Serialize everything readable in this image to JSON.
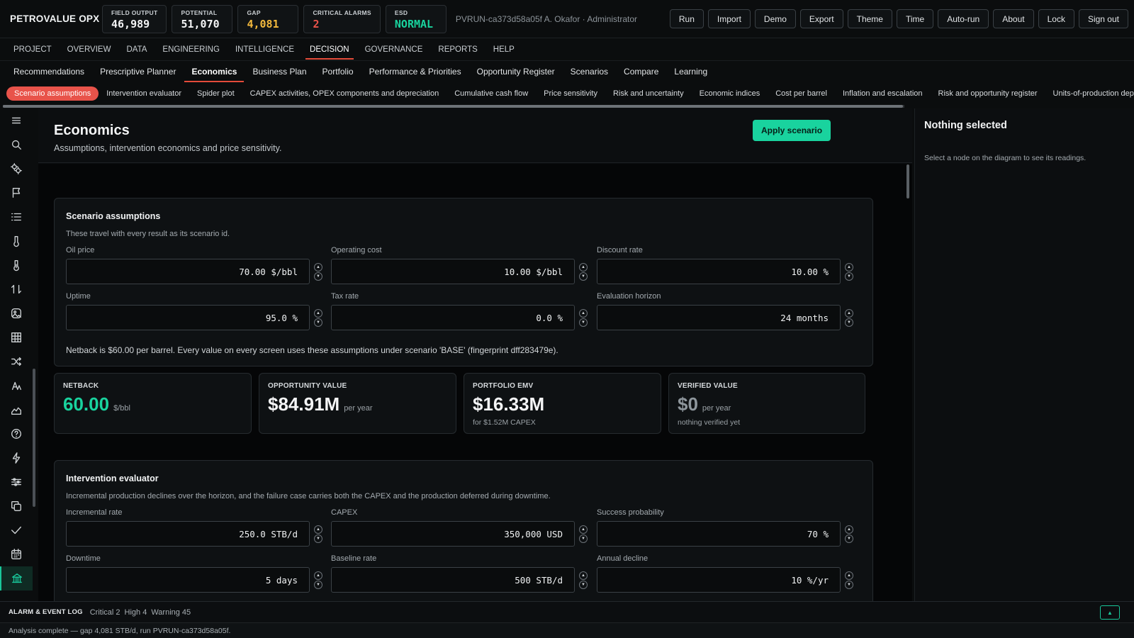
{
  "brand": "PETROVALUE OPX",
  "kpis": [
    {
      "label": "FIELD OUTPUT",
      "value": "46,989",
      "color": "#f3f4f5"
    },
    {
      "label": "POTENTIAL",
      "value": "51,070",
      "color": "#f3f4f5"
    },
    {
      "label": "GAP",
      "value": "4,081",
      "color": "#f3b93d"
    },
    {
      "label": "CRITICAL ALARMS",
      "value": "2",
      "color": "#e8534a"
    },
    {
      "label": "ESD",
      "value": "NORMAL",
      "color": "#19d39e"
    }
  ],
  "run_info": "PVRUN-ca373d58a05f   A. Okafor · Administrator",
  "top_actions": [
    "Run",
    "Import",
    "Demo",
    "Export",
    "Theme",
    "Time",
    "Auto-run",
    "About",
    "Lock",
    "Sign out"
  ],
  "main_nav": [
    "PROJECT",
    "OVERVIEW",
    "DATA",
    "ENGINEERING",
    "INTELLIGENCE",
    "DECISION",
    "GOVERNANCE",
    "REPORTS",
    "HELP"
  ],
  "main_nav_active": "DECISION",
  "sub_nav": [
    "Recommendations",
    "Prescriptive Planner",
    "Economics",
    "Business Plan",
    "Portfolio",
    "Performance & Priorities",
    "Opportunity Register",
    "Scenarios",
    "Compare",
    "Learning"
  ],
  "sub_nav_active": "Economics",
  "chips": [
    "Scenario assumptions",
    "Intervention evaluator",
    "Spider plot",
    "CAPEX activities, OPEX components and depreciation",
    "Cumulative cash flow",
    "Price sensitivity",
    "Risk and uncertainty",
    "Economic indices",
    "Cost per barrel",
    "Inflation and escalation",
    "Risk and opportunity register",
    "Units-of-production deprec"
  ],
  "chips_active": "Scenario assumptions",
  "rail_icons": [
    "menu-icon",
    "search-icon",
    "gears-icon",
    "flag-icon",
    "list-icon",
    "thermometer-icon",
    "thermometer-alt-icon",
    "transfer-icon",
    "image-icon",
    "grid-icon",
    "shuffle-icon",
    "text-icon",
    "area-chart-icon",
    "help-icon",
    "lightning-icon",
    "sliders-icon",
    "copy-icon",
    "check-icon",
    "calendar-icon",
    "bank-icon"
  ],
  "page": {
    "title": "Economics",
    "subtitle": "Assumptions, intervention economics and price sensitivity.",
    "apply_label": "Apply scenario"
  },
  "scenario": {
    "title": "Scenario assumptions",
    "desc": "These travel with every result as its scenario id.",
    "fields": [
      {
        "label": "Oil price",
        "value": "70.00 $/bbl"
      },
      {
        "label": "Operating cost",
        "value": "10.00 $/bbl"
      },
      {
        "label": "Discount rate",
        "value": "10.00 %"
      },
      {
        "label": "Uptime",
        "value": "95.0 %"
      },
      {
        "label": "Tax rate",
        "value": "0.0 %"
      },
      {
        "label": "Evaluation horizon",
        "value": "24 months"
      }
    ],
    "note": "Netback is $60.00 per barrel. Every value on every screen uses these assumptions under scenario 'BASE' (fingerprint dff283479e)."
  },
  "metrics": [
    {
      "label": "NETBACK",
      "value": "60.00",
      "unit": "$/bbl",
      "sub": "",
      "color": "#19d39e"
    },
    {
      "label": "OPPORTUNITY VALUE",
      "value": "$84.91M",
      "unit": "per year",
      "sub": "",
      "color": "#f4f5f6"
    },
    {
      "label": "PORTFOLIO EMV",
      "value": "$16.33M",
      "unit": "",
      "sub": "for $1.52M CAPEX",
      "color": "#f4f5f6"
    },
    {
      "label": "VERIFIED VALUE",
      "value": "$0",
      "unit": "per year",
      "sub": "nothing verified yet",
      "color": "#8e969c"
    }
  ],
  "intervention": {
    "title": "Intervention evaluator",
    "desc": "Incremental production declines over the horizon, and the failure case carries both the CAPEX and the production deferred during downtime.",
    "fields": [
      {
        "label": "Incremental rate",
        "value": "250.0 STB/d"
      },
      {
        "label": "CAPEX",
        "value": "350,000 USD"
      },
      {
        "label": "Success probability",
        "value": "70 %"
      },
      {
        "label": "Downtime",
        "value": "5 days"
      },
      {
        "label": "Baseline rate",
        "value": "500 STB/d"
      },
      {
        "label": "Annual decline",
        "value": "10 %/yr"
      }
    ]
  },
  "right_panel": {
    "title": "Nothing selected",
    "text": "Select a node on the diagram to see its readings."
  },
  "alarm_bar": {
    "label": "ALARM & EVENT LOG",
    "counts": [
      "Critical 2",
      "High 4",
      "Warning 45"
    ]
  },
  "status": "Analysis complete — gap 4,081 STB/d, run PVRUN-ca373d58a05f."
}
